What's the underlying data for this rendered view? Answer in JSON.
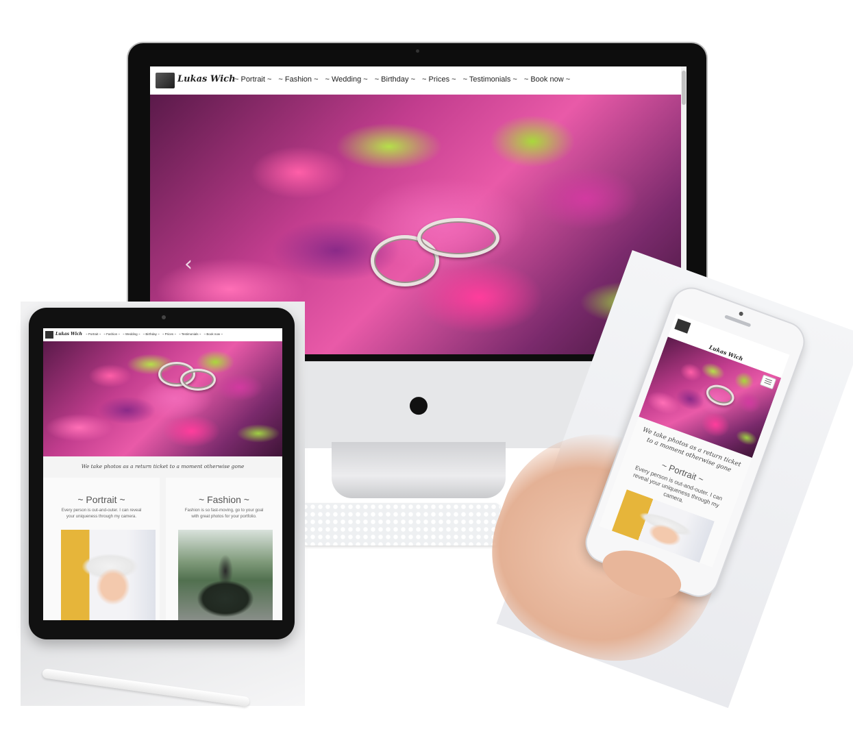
{
  "site": {
    "logo_text": "Lukas Wich",
    "menu": [
      "~ Portrait ~",
      "~ Fashion ~",
      "~ Wedding ~",
      "~ Birthday ~",
      "~ Prices ~",
      "~ Testimonials ~",
      "~ Book now ~"
    ],
    "tagline": "We take photos as a return ticket to a moment otherwise gone",
    "slider_prev": "‹",
    "slider_next": "›"
  },
  "sections": [
    {
      "title": "~ Portrait ~",
      "text": "Every person is out-and-outer. I can reveal your uniqueness through my camera."
    },
    {
      "title": "~ Fashion ~",
      "text": "Fashion is so fast-moving, go to your goal with great photos for your portfolio."
    }
  ],
  "phone_title": "~ Portrait ~",
  "icons": {
    "device": "apple-logo",
    "menu": "hamburger-icon",
    "prev": "chevron-left-icon",
    "next": "chevron-right-icon"
  },
  "colors": {
    "accent_pink": "#e95aa8",
    "nav_bg": "#ffffff",
    "screen_bg": "#f4f4f4"
  }
}
